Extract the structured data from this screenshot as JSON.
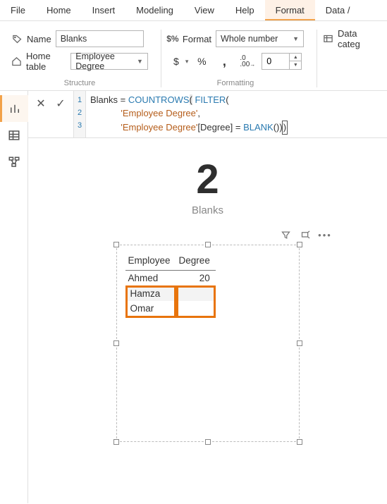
{
  "menu": {
    "items": [
      "File",
      "Home",
      "Insert",
      "Modeling",
      "View",
      "Help",
      "Format",
      "Data /"
    ],
    "activeIndex": 6
  },
  "ribbon": {
    "name_label": "Name",
    "name_value": "Blanks",
    "hometable_label": "Home table",
    "hometable_value": "Employee Degree",
    "group1_label": "Structure",
    "format_label": "Format",
    "format_value": "Whole number",
    "currency": "$",
    "percent": "%",
    "thousands": ",",
    "decimals_icon": ".0 .00",
    "decimals_value": "0",
    "group2_label": "Formatting",
    "datacat_label": "Data categ"
  },
  "formula": {
    "lines": [
      "1",
      "2",
      "3"
    ],
    "l1_a": "Blanks = ",
    "l1_b": "COUNTROWS",
    "l1_c": "(",
    "l1_d": " FILTER",
    "l1_e": "(",
    "l2_a": "            ",
    "l2_b": "'Employee Degree'",
    "l2_c": ",",
    "l3_a": "            ",
    "l3_b": "'Employee Degree'",
    "l3_c": "[Degree] = ",
    "l3_d": "BLANK",
    "l3_e": "())",
    "l3_f": ")"
  },
  "card": {
    "value": "2",
    "label": "Blanks"
  },
  "table": {
    "cols": [
      "Employee",
      "Degree"
    ],
    "rows": [
      {
        "emp": "Ahmed",
        "deg": "20"
      },
      {
        "emp": "Hamza",
        "deg": ""
      },
      {
        "emp": "Omar",
        "deg": ""
      }
    ]
  }
}
